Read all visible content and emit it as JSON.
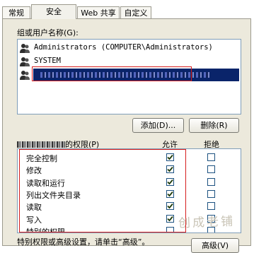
{
  "tabs": [
    "常规",
    "安全",
    "Web 共享",
    "自定义"
  ],
  "active_tab": "安全",
  "groups_label": "组或用户名称(G):",
  "users": [
    {
      "name": "Administrators (COMPUTER\\Administrators)",
      "selected": false
    },
    {
      "name": "SYSTEM",
      "selected": false
    },
    {
      "name": "",
      "selected": true
    }
  ],
  "buttons": {
    "add": "添加(D)...",
    "remove": "删除(R)",
    "advanced": "高级(V)"
  },
  "permissions": {
    "header_suffix": "的权限(P)",
    "allow_header": "允许",
    "deny_header": "拒绝",
    "rows": [
      {
        "label": "完全控制",
        "allow": true,
        "deny": false
      },
      {
        "label": "修改",
        "allow": true,
        "deny": false
      },
      {
        "label": "读取和运行",
        "allow": true,
        "deny": false
      },
      {
        "label": "列出文件夹目录",
        "allow": true,
        "deny": false
      },
      {
        "label": "读取",
        "allow": true,
        "deny": false
      },
      {
        "label": "写入",
        "allow": true,
        "deny": false
      },
      {
        "label": "特别的权限",
        "allow": false,
        "deny": false
      }
    ]
  },
  "special_note": "特别权限或高级设置，请单击“高级”。",
  "watermark": "创成老铺",
  "colors": {
    "highlight_box": "#d61c1c",
    "selection": "#0a246a",
    "checkmark": "#1f3b0a"
  }
}
